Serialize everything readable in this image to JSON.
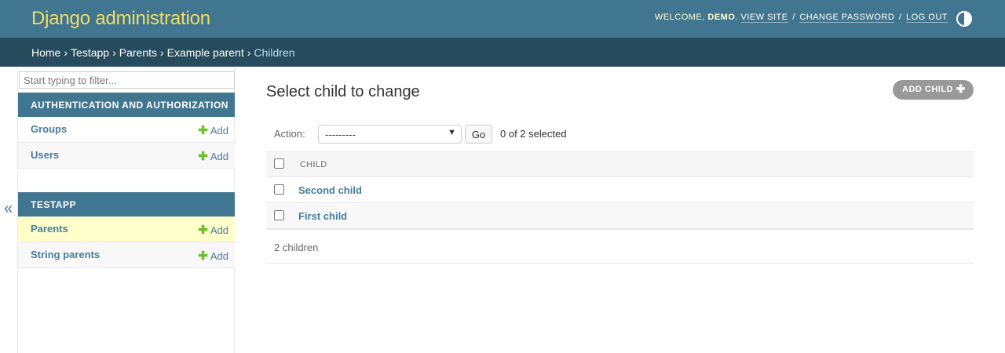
{
  "header": {
    "branding": "Django administration",
    "welcome": "WELCOME, ",
    "username": "DEMO",
    "welcome_end": ". ",
    "view_site": "VIEW SITE",
    "change_password": "CHANGE PASSWORD",
    "log_out": "LOG OUT",
    "separator": "/"
  },
  "breadcrumbs": {
    "items": [
      "Home",
      "Testapp",
      "Parents",
      "Example parent"
    ],
    "current": "Children",
    "separator": "›"
  },
  "sidebar": {
    "filter_placeholder": "Start typing to filter...",
    "collapse_glyph": "«",
    "modules": [
      {
        "caption": "AUTHENTICATION AND AUTHORIZATION",
        "models": [
          {
            "name": "Groups",
            "add": "Add"
          },
          {
            "name": "Users",
            "add": "Add"
          }
        ]
      },
      {
        "caption": "TESTAPP",
        "models": [
          {
            "name": "Parents",
            "add": "Add",
            "current": true
          },
          {
            "name": "String parents",
            "add": "Add"
          }
        ]
      }
    ]
  },
  "content": {
    "title": "Select child to change",
    "add_button": "ADD CHILD",
    "action_label": "Action:",
    "action_selected": "---------",
    "go_button": "Go",
    "selected_count": "0 of 2 selected",
    "column_header": "CHILD",
    "rows": [
      "Second child",
      "First child"
    ],
    "paginator": "2 children"
  },
  "colors": {
    "header_bg": "#417690",
    "breadcrumb_bg": "#264b5d",
    "branding": "#f5dd5d",
    "link": "#447e9b",
    "add_icon": "#70bf2b",
    "current_row": "#ffffcc"
  }
}
